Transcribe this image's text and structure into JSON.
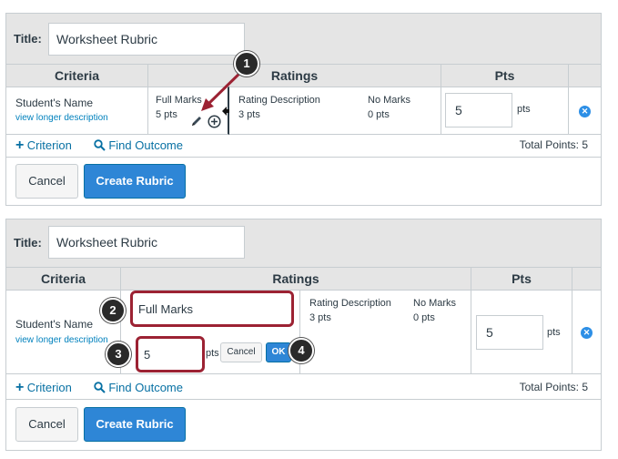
{
  "rubric1": {
    "title_label": "Title:",
    "title_value": "Worksheet Rubric",
    "headers": {
      "criteria": "Criteria",
      "ratings": "Ratings",
      "pts": "Pts"
    },
    "criterion_name": "Student's Name",
    "criterion_link": "view longer description",
    "ratings": [
      {
        "label": "Full Marks",
        "pts": "5 pts"
      },
      {
        "label": "Rating Description",
        "pts": "3 pts"
      },
      {
        "label": "No Marks",
        "pts": "0 pts"
      }
    ],
    "points_value": "5",
    "points_unit": "pts",
    "add_criterion": "Criterion",
    "find_outcome": "Find Outcome",
    "total_points": "Total Points: 5",
    "cancel": "Cancel",
    "create": "Create Rubric"
  },
  "rubric2": {
    "title_label": "Title:",
    "title_value": "Worksheet Rubric",
    "headers": {
      "criteria": "Criteria",
      "ratings": "Ratings",
      "pts": "Pts"
    },
    "criterion_name": "Student's Name",
    "criterion_link": "view longer description",
    "edit_rating_label": "Full Marks",
    "edit_rating_pts": "5",
    "edit_pts_unit": "pts",
    "edit_cancel": "Cancel",
    "edit_ok": "OK",
    "ratings": [
      {
        "label": "Rating Description",
        "pts": "3 pts"
      },
      {
        "label": "No Marks",
        "pts": "0 pts"
      }
    ],
    "points_value": "5",
    "points_unit": "pts",
    "add_criterion": "Criterion",
    "find_outcome": "Find Outcome",
    "total_points": "Total Points: 5",
    "cancel": "Cancel",
    "create": "Create Rubric"
  },
  "callouts": [
    "1",
    "2",
    "3",
    "4"
  ],
  "colors": {
    "accent": "#2e86d6",
    "link": "#0770a3",
    "callout_border": "#9c2233",
    "header_bg": "#e5e5e5"
  },
  "icons": [
    "pencil-icon",
    "plus-circle-icon",
    "resize-arrows-icon",
    "remove-icon",
    "plus-icon",
    "search-icon"
  ]
}
